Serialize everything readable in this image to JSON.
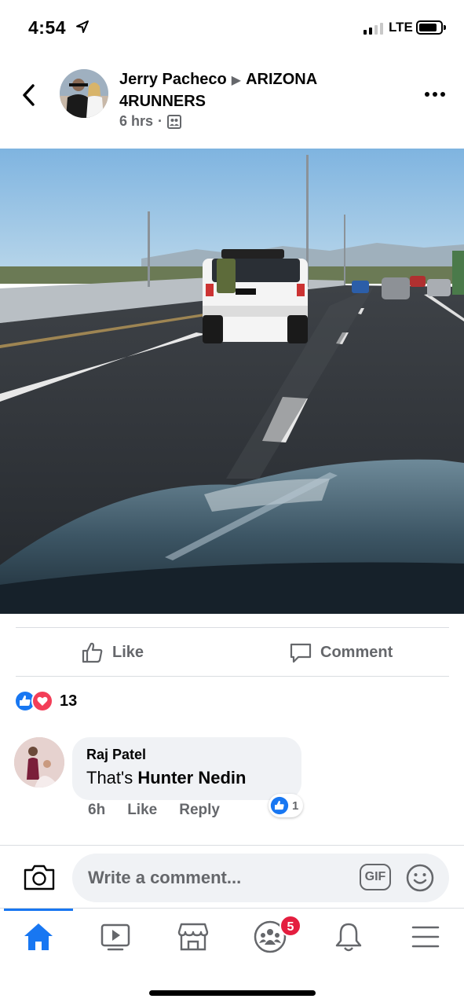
{
  "status_bar": {
    "time": "4:54",
    "network": "LTE"
  },
  "post": {
    "author": "Jerry Pacheco",
    "group": "ARIZONA 4RUNNERS",
    "time": "6 hrs",
    "audience_icon": "group-members-icon"
  },
  "actions": {
    "like_label": "Like",
    "comment_label": "Comment"
  },
  "reactions": {
    "count": "13",
    "types": [
      "like",
      "love"
    ]
  },
  "comment": {
    "author": "Raj Patel",
    "text_prefix": "That's ",
    "text_bold": "Hunter Nedin",
    "time": "6h",
    "like_label": "Like",
    "reply_label": "Reply",
    "like_count": "1"
  },
  "composer": {
    "placeholder": "Write a comment...",
    "gif_label": "GIF"
  },
  "tabbar": {
    "items": [
      "home-icon",
      "watch-icon",
      "marketplace-icon",
      "groups-icon",
      "notifications-icon",
      "menu-icon"
    ],
    "groups_badge": "5"
  },
  "colors": {
    "accent": "#1877f2",
    "love": "#f33e58",
    "badge": "#e41e3f",
    "secondary_text": "#65676b"
  }
}
